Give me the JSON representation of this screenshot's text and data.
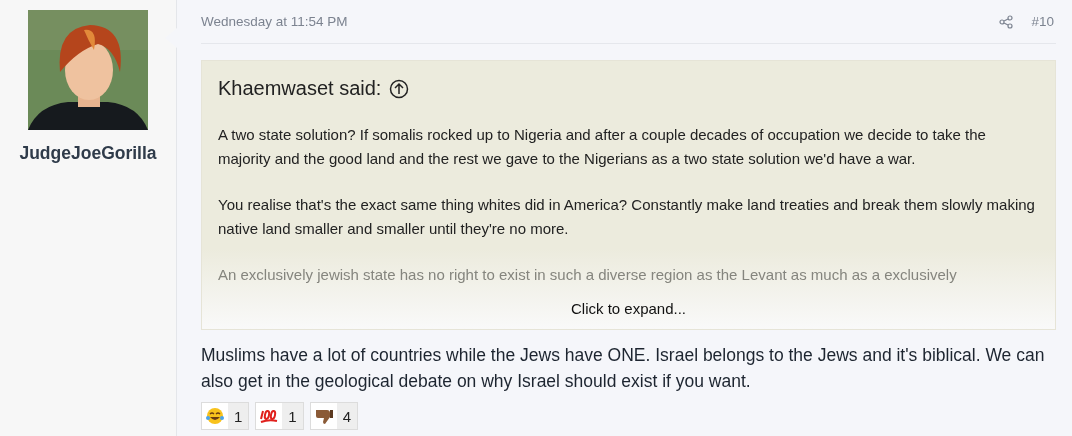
{
  "author": {
    "username": "JudgeJoeGorilla"
  },
  "post": {
    "timestamp": "Wednesday at 11:54 PM",
    "number": "#10",
    "quote": {
      "title": "Khaemwaset said:",
      "paragraphs": [
        "A two state solution? If somalis rocked up to Nigeria and after a couple decades of occupation we decide to take the majority and the good land and the rest we gave to the Nigerians as a two state solution we'd have a war.",
        "You realise that's the exact same thing whites did in America? Constantly make land treaties and break them slowly making native land smaller and smaller until they're no more.",
        "An exclusively jewish state has no right to exist in such a diverse region as the Levant as much as a exclusively"
      ],
      "expand": "Click to expand..."
    },
    "body": "Muslims have a lot of countries while the Jews have ONE. Israel belongs to the Jews and it's biblical. We can also get in the geological debate on why Israel should exist if you want.",
    "reactions": [
      {
        "kind": "laugh",
        "count": "1"
      },
      {
        "kind": "hundred",
        "count": "1"
      },
      {
        "kind": "thumbs-down",
        "count": "4"
      }
    ]
  }
}
